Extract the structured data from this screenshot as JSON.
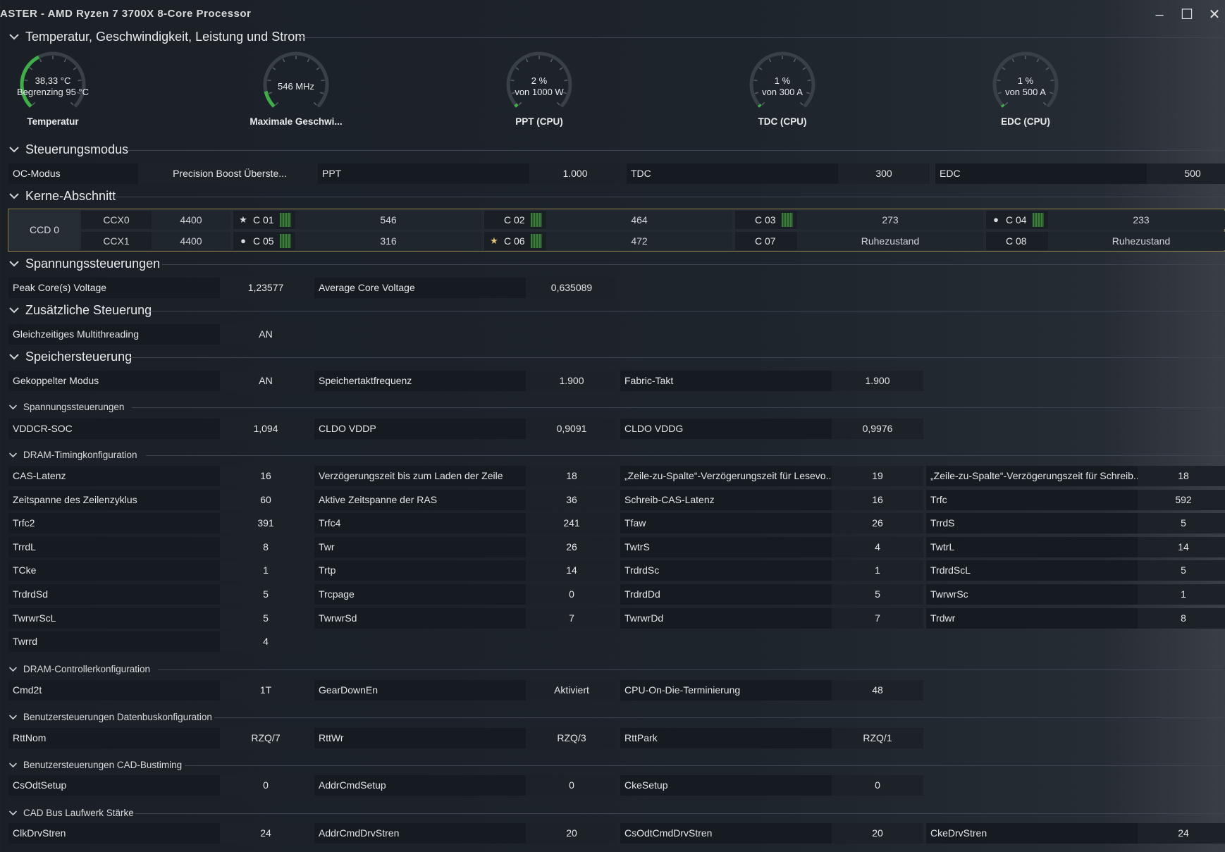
{
  "window": {
    "title": "ASTER  -  AMD Ryzen 7 3700X 8-Core Processor",
    "minimize": "–",
    "maximize": "☐",
    "close": "✕"
  },
  "sections": {
    "temp": "Temperatur, Geschwindigkeit, Leistung und Strom",
    "control": "Steuerungsmodus",
    "cores": "Kerne-Abschnitt",
    "voltage": "Spannungssteuerungen",
    "additional": "Zusätzliche Steuerung",
    "memory": "Speichersteuerung",
    "mem_voltage": "Spannungssteuerungen",
    "dram_timing": "DRAM-Timingkonfiguration",
    "dram_ctrl": "DRAM-Controllerkonfiguration",
    "databus": "Benutzersteuerungen Datenbuskonfiguration",
    "cad_timing": "Benutzersteuerungen CAD-Bustiming",
    "cad_drive": "CAD Bus Laufwerk Stärke"
  },
  "gauges": [
    {
      "line1": "38,33 °C",
      "line2": "Begrenzing  95 °C",
      "name": "Temperatur",
      "fraction": 0.4,
      "color": "#3fae49"
    },
    {
      "line1": "546  MHz",
      "line2": "",
      "name": "Maximale Geschwi...",
      "fraction": 0.12,
      "color": "#3fae49"
    },
    {
      "line1": "2 %",
      "line2": "von  1000 W",
      "name": "PPT (CPU)",
      "fraction": 0.02,
      "color": "#3fae49"
    },
    {
      "line1": "1 %",
      "line2": "von  300 A",
      "name": "TDC (CPU)",
      "fraction": 0.01,
      "color": "#3fae49"
    },
    {
      "line1": "1 %",
      "line2": "von  500 A",
      "name": "EDC (CPU)",
      "fraction": 0.01,
      "color": "#3fae49"
    }
  ],
  "control_row": [
    {
      "label": "OC-Modus",
      "value": "Precision Boost Überste..."
    },
    {
      "label": "PPT",
      "value": "1.000"
    },
    {
      "label": "TDC",
      "value": "300"
    },
    {
      "label": "EDC",
      "value": "500"
    }
  ],
  "ccd": {
    "label": "CCD 0",
    "ccx": [
      {
        "name": "CCX0",
        "freq": "4400"
      },
      {
        "name": "CCX1",
        "freq": "4400"
      }
    ],
    "cores": [
      {
        "name": "C 01",
        "value": "546",
        "mark": "★",
        "bar": true
      },
      {
        "name": "C 02",
        "value": "464",
        "mark": "",
        "bar": true
      },
      {
        "name": "C 03",
        "value": "273",
        "mark": "",
        "bar": true
      },
      {
        "name": "C 04",
        "value": "233",
        "mark": "●",
        "bar": true
      },
      {
        "name": "C 05",
        "value": "316",
        "mark": "●",
        "bar": true
      },
      {
        "name": "C 06",
        "value": "472",
        "mark": "★",
        "bar": true
      },
      {
        "name": "C 07",
        "value": "Ruhezustand",
        "mark": "",
        "bar": false
      },
      {
        "name": "C 08",
        "value": "Ruhezustand",
        "mark": "",
        "bar": false
      }
    ]
  },
  "voltage_row": [
    {
      "label": "Peak Core(s) Voltage",
      "value": "1,23577"
    },
    {
      "label": "Average Core Voltage",
      "value": "0,635089"
    }
  ],
  "additional_row": [
    {
      "label": "Gleichzeitiges Multithreading",
      "value": "AN"
    }
  ],
  "memory_row": [
    {
      "label": "Gekoppelter Modus",
      "value": "AN"
    },
    {
      "label": "Speichertaktfrequenz",
      "value": "1.900"
    },
    {
      "label": "Fabric-Takt",
      "value": "1.900"
    }
  ],
  "mem_voltage_row": [
    {
      "label": "VDDCR-SOC",
      "value": "1,094"
    },
    {
      "label": "CLDO VDDP",
      "value": "0,9091"
    },
    {
      "label": "CLDO VDDG",
      "value": "0,9976"
    }
  ],
  "dram_timing": [
    [
      {
        "label": "CAS-Latenz",
        "value": "16"
      },
      {
        "label": "Verzögerungszeit bis zum Laden der Zeile",
        "value": "18"
      },
      {
        "label": "„Zeile-zu-Spalte“-Verzögerungszeit für Lesevo...",
        "value": "19"
      },
      {
        "label": "„Zeile-zu-Spalte“-Verzögerungszeit für Schreib...",
        "value": "18"
      }
    ],
    [
      {
        "label": "Zeitspanne des Zeilenzyklus",
        "value": "60"
      },
      {
        "label": "Aktive Zeitspanne der RAS",
        "value": "36"
      },
      {
        "label": "Schreib-CAS-Latenz",
        "value": "16"
      },
      {
        "label": "Trfc",
        "value": "592"
      }
    ],
    [
      {
        "label": "Trfc2",
        "value": "391"
      },
      {
        "label": "Trfc4",
        "value": "241"
      },
      {
        "label": "Tfaw",
        "value": "26"
      },
      {
        "label": "TrrdS",
        "value": "5"
      }
    ],
    [
      {
        "label": "TrrdL",
        "value": "8"
      },
      {
        "label": "Twr",
        "value": "26"
      },
      {
        "label": "TwtrS",
        "value": "4"
      },
      {
        "label": "TwtrL",
        "value": "14"
      }
    ],
    [
      {
        "label": "TCke",
        "value": "1"
      },
      {
        "label": "Trtp",
        "value": "14"
      },
      {
        "label": "TrdrdSc",
        "value": "1"
      },
      {
        "label": "TrdrdScL",
        "value": "5"
      }
    ],
    [
      {
        "label": "TrdrdSd",
        "value": "5"
      },
      {
        "label": "Trcpage",
        "value": "0"
      },
      {
        "label": "TrdrdDd",
        "value": "5"
      },
      {
        "label": "TwrwrSc",
        "value": "1"
      }
    ],
    [
      {
        "label": "TwrwrScL",
        "value": "5"
      },
      {
        "label": "TwrwrSd",
        "value": "7"
      },
      {
        "label": "TwrwrDd",
        "value": "7"
      },
      {
        "label": "Trdwr",
        "value": "8"
      }
    ],
    [
      {
        "label": "Twrrd",
        "value": "4"
      }
    ]
  ],
  "dram_ctrl_row": [
    {
      "label": "Cmd2t",
      "value": "1T"
    },
    {
      "label": "GearDownEn",
      "value": "Aktiviert"
    },
    {
      "label": "CPU-On-Die-Terminierung",
      "value": "48"
    }
  ],
  "databus_row": [
    {
      "label": "RttNom",
      "value": "RZQ/7"
    },
    {
      "label": "RttWr",
      "value": "RZQ/3"
    },
    {
      "label": "RttPark",
      "value": "RZQ/1"
    }
  ],
  "cad_timing_row": [
    {
      "label": "CsOdtSetup",
      "value": "0"
    },
    {
      "label": "AddrCmdSetup",
      "value": "0"
    },
    {
      "label": "CkeSetup",
      "value": "0"
    }
  ],
  "cad_drive_row": [
    {
      "label": "ClkDrvStren",
      "value": "24"
    },
    {
      "label": "AddrCmdDrvStren",
      "value": "20"
    },
    {
      "label": "CsOdtCmdDrvStren",
      "value": "20"
    },
    {
      "label": "CkeDrvStren",
      "value": "24"
    }
  ],
  "colors": {
    "accent_green": "#3fae49",
    "core_border": "#8d7e43",
    "star": "#e8c27a"
  }
}
